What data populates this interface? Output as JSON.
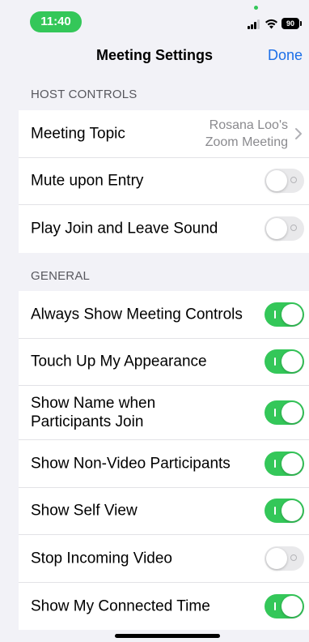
{
  "status_bar": {
    "time": "11:40",
    "battery": "90"
  },
  "nav": {
    "title": "Meeting Settings",
    "done_label": "Done"
  },
  "host_controls": {
    "header": "HOST CONTROLS",
    "meeting_topic": {
      "label": "Meeting Topic",
      "value_line1": "Rosana Loo's",
      "value_line2": "Zoom Meeting"
    },
    "mute_upon_entry": {
      "label": "Mute upon Entry",
      "on": false
    },
    "play_join_leave_sound": {
      "label": "Play Join and Leave Sound",
      "on": false
    }
  },
  "general": {
    "header": "GENERAL",
    "items": [
      {
        "label": "Always Show Meeting Controls",
        "on": true
      },
      {
        "label": "Touch Up My Appearance",
        "on": true
      },
      {
        "label": "Show Name when Participants Join",
        "on": true
      },
      {
        "label": "Show Non-Video Participants",
        "on": true
      },
      {
        "label": "Show Self View",
        "on": true
      },
      {
        "label": "Stop Incoming Video",
        "on": false
      },
      {
        "label": "Show My Connected Time",
        "on": true
      }
    ]
  },
  "colors": {
    "toggle_on": "#34c759",
    "toggle_off": "#e9e9eb",
    "accent": "#1c6fe8"
  }
}
